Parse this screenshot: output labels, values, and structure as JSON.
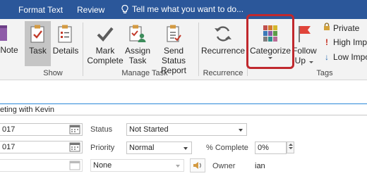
{
  "tabs": [
    {
      "label": "Format Text"
    },
    {
      "label": "Review"
    }
  ],
  "tell_me": {
    "placeholder": "Tell me what you want to do..."
  },
  "ribbon": {
    "buttons": {
      "note": "Note",
      "task": "Task",
      "details": "Details",
      "mark_complete": [
        "Mark",
        "Complete"
      ],
      "assign_task": [
        "Assign",
        "Task"
      ],
      "send_status_report": [
        "Send Status",
        "Report"
      ],
      "recurrence": "Recurrence",
      "categorize": "Categorize",
      "follow_up": [
        "Follow",
        "Up"
      ]
    },
    "tags": {
      "private": "Private",
      "high_importance": "High Impo",
      "low_importance": "Low Impo"
    },
    "groups": {
      "show": "Show",
      "manage_task": "Manage Task",
      "recurrence": "Recurrence",
      "tags": "Tags"
    }
  },
  "form": {
    "subject": "eting with Kevin",
    "start_date": "017",
    "due_date": "017",
    "status_label": "Status",
    "status_value": "Not Started",
    "priority_label": "Priority",
    "priority_value": "Normal",
    "percent_label": "% Complete",
    "percent_value": "0%",
    "reminder_value": "None",
    "owner_label": "Owner",
    "owner_value": "ian"
  },
  "colors": {
    "accent": "#2b579a",
    "highlight": "#c0282d",
    "follow_up_flag": "#e0443a",
    "high_importance": "#c42b1c",
    "low_importance": "#2b6cb0"
  }
}
